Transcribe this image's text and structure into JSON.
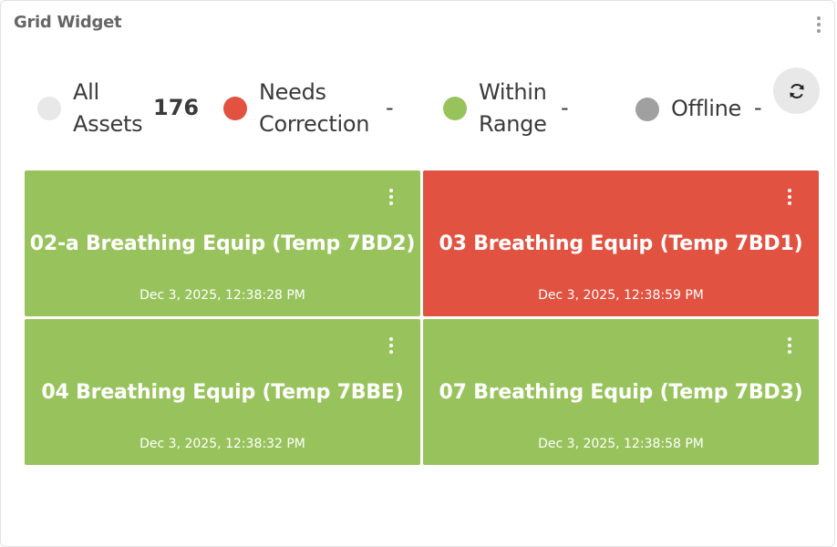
{
  "widget": {
    "title": "Grid Widget"
  },
  "legend": {
    "all": {
      "line1": "All",
      "line2": "Assets",
      "count": "176",
      "color": "#e8e8e8"
    },
    "needs_correction": {
      "line1": "Needs",
      "line2": "Correction",
      "count": "-",
      "color": "#e25241"
    },
    "within_range": {
      "line1": "Within",
      "line2": "Range",
      "count": "-",
      "color": "#98c35c"
    },
    "offline": {
      "label": "Offline",
      "count": "-",
      "color": "#a0a0a0"
    }
  },
  "refresh": {
    "icon": "refresh-icon"
  },
  "tiles": [
    {
      "name": "02-a Breathing Equip (Temp 7BD2)",
      "timestamp": "Dec 3, 2025, 12:38:28 PM",
      "status": "within-range",
      "color": "#98c35c"
    },
    {
      "name": "03 Breathing Equip (Temp 7BD1)",
      "timestamp": "Dec 3, 2025, 12:38:59 PM",
      "status": "needs-correction",
      "color": "#e25241"
    },
    {
      "name": "04 Breathing Equip (Temp 7BBE)",
      "timestamp": "Dec 3, 2025, 12:38:32 PM",
      "status": "within-range",
      "color": "#98c35c"
    },
    {
      "name": "07 Breathing Equip (Temp 7BD3)",
      "timestamp": "Dec 3, 2025, 12:38:58 PM",
      "status": "within-range",
      "color": "#98c35c"
    }
  ]
}
